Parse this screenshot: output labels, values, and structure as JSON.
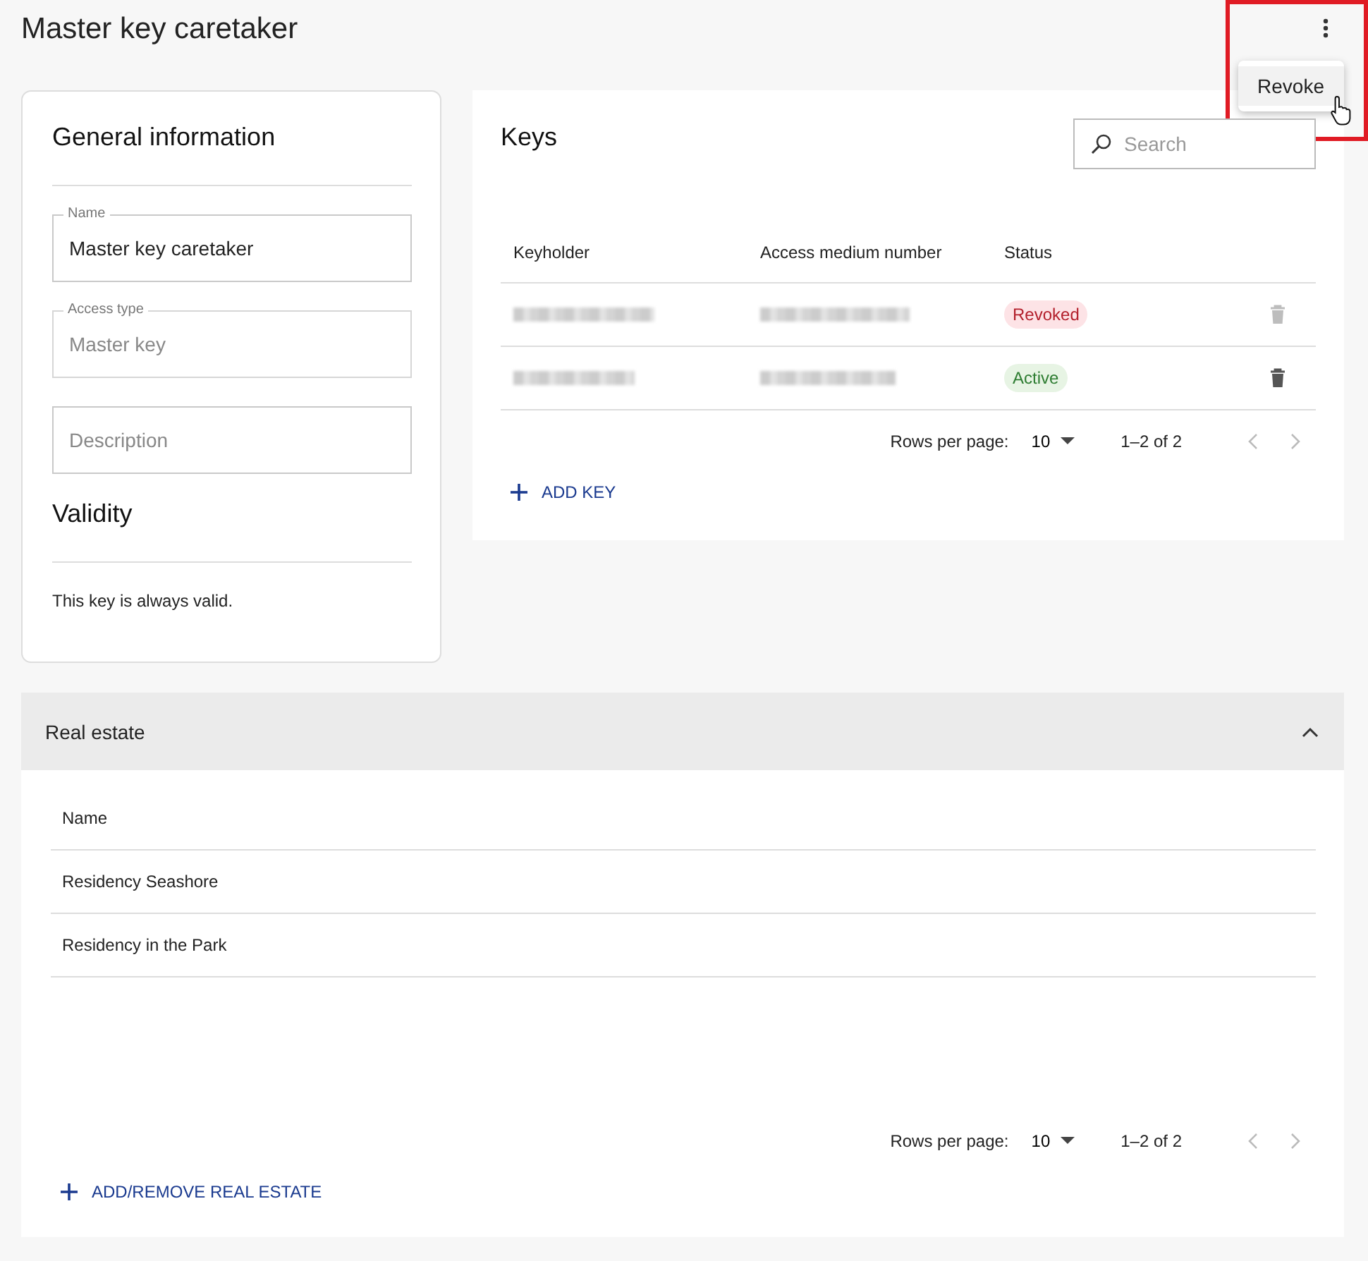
{
  "page_title": "Master key caretaker",
  "menu": {
    "open": true,
    "highlighted": true,
    "items": [
      {
        "label": "Revoke",
        "hovered": true
      }
    ]
  },
  "general": {
    "title": "General information",
    "fields": [
      {
        "label": "Name",
        "value": "Master key caretaker",
        "disabled": false
      },
      {
        "label": "Access type",
        "value": "Master key",
        "disabled": true
      },
      {
        "placeholder": "Description"
      }
    ],
    "validity_title": "Validity",
    "validity_text": "This key is always valid."
  },
  "keys": {
    "title": "Keys",
    "search": {
      "placeholder": "Search"
    },
    "columns": [
      "Keyholder",
      "Access medium number",
      "Status"
    ],
    "rows": [
      {
        "status": "Revoked",
        "kind": "revoked",
        "delete_disabled": true
      },
      {
        "status": "Active",
        "kind": "active",
        "delete_disabled": false
      }
    ],
    "pagination": {
      "rows_label": "Rows per page:",
      "rows_value": "10",
      "range": "1–2 of 2",
      "prev_disabled": true,
      "next_disabled": true
    },
    "add_label": "ADD KEY"
  },
  "real_estate": {
    "title": "Real estate",
    "expanded": true,
    "columns": [
      "Name"
    ],
    "rows": [
      "Residency Seashore",
      "Residency in the Park"
    ],
    "pagination": {
      "rows_label": "Rows per page:",
      "rows_value": "10",
      "range": "1–2 of 2",
      "prev_disabled": true,
      "next_disabled": true
    },
    "add_label": "ADD/REMOVE REAL ESTATE"
  }
}
